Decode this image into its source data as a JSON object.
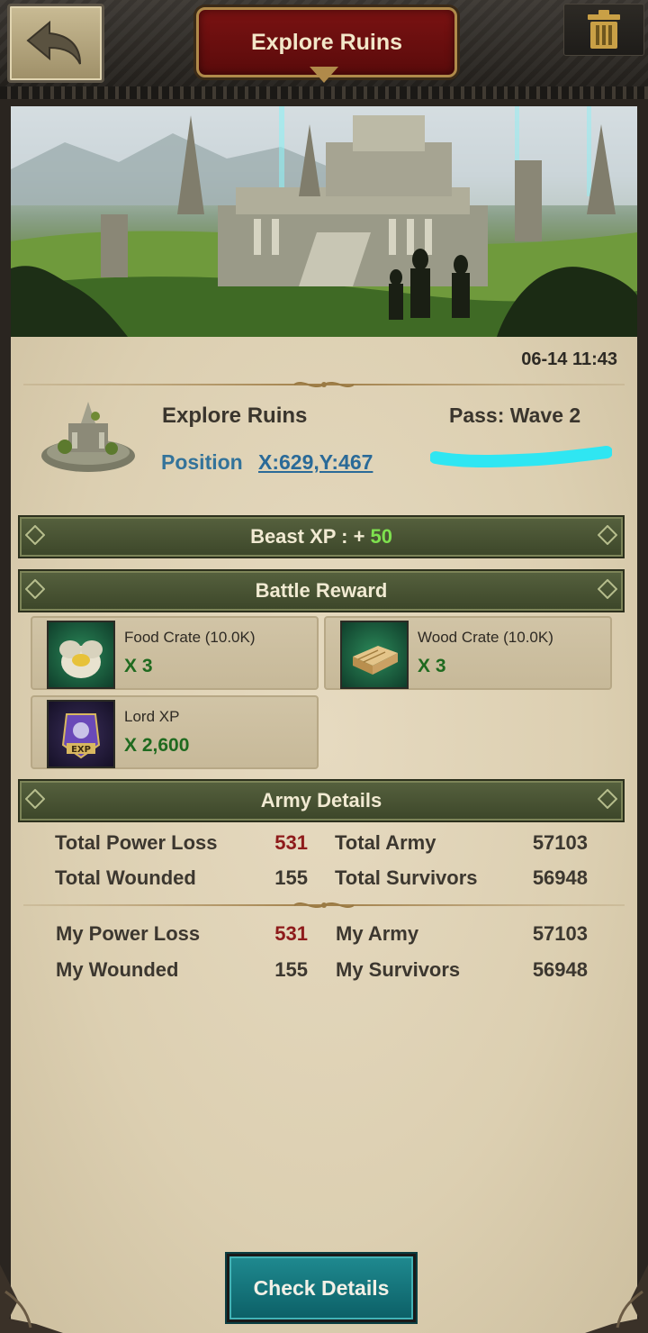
{
  "header": {
    "title": "Explore Ruins",
    "back_icon": "back-arrow-icon",
    "trash_icon": "trash-icon"
  },
  "report": {
    "timestamp": "06-14 11:43",
    "title": "Explore Ruins",
    "pass": "Pass: Wave 2",
    "position_label": "Position",
    "position_value": "X:629,Y:467"
  },
  "beast_xp": {
    "label": "Beast XP : +",
    "value": "50"
  },
  "battle_reward": {
    "title": "Battle Reward",
    "items": [
      {
        "name": "Food Crate (10.0K)",
        "qty": "X 3",
        "icon": "food-crate-icon"
      },
      {
        "name": "Wood Crate (10.0K)",
        "qty": "X 3",
        "icon": "wood-crate-icon"
      },
      {
        "name": "Lord XP",
        "qty": "X 2,600",
        "icon": "lord-xp-icon"
      }
    ]
  },
  "army_details": {
    "title": "Army Details",
    "total": {
      "power_loss_label": "Total Power Loss",
      "power_loss": "531",
      "army_label": "Total Army",
      "army": "57103",
      "wounded_label": "Total Wounded",
      "wounded": "155",
      "survivors_label": "Total Survivors",
      "survivors": "56948"
    },
    "mine": {
      "power_loss_label": "My Power Loss",
      "power_loss": "531",
      "army_label": "My Army",
      "army": "57103",
      "wounded_label": "My Wounded",
      "wounded": "155",
      "survivors_label": "My Survivors",
      "survivors": "56948"
    }
  },
  "footer": {
    "check_details": "Check Details"
  },
  "colors": {
    "title_red": "#7a1212",
    "section_green": "#4a5434",
    "xp_green": "#7ee04e",
    "loss_red": "#8e1b1b",
    "button_teal": "#1a7f86",
    "link_blue": "#2a6a98"
  }
}
